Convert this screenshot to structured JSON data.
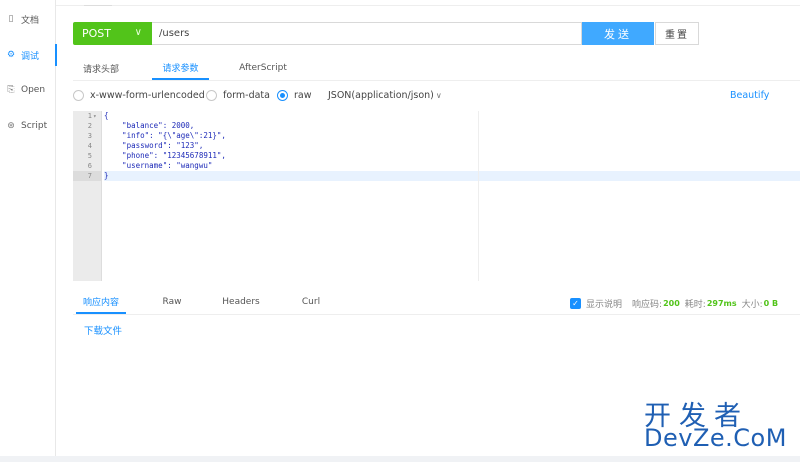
{
  "sidebar": {
    "items": [
      {
        "icon": "document-icon",
        "glyph": "▯",
        "label": "文档"
      },
      {
        "icon": "debug-icon",
        "glyph": "⚙",
        "label": "调试"
      },
      {
        "icon": "open-icon",
        "glyph": "⎘",
        "label": "Open"
      },
      {
        "icon": "script-icon",
        "glyph": "⊛",
        "label": "Script"
      }
    ]
  },
  "request": {
    "method": "POST",
    "url": "/users",
    "send_label": "发送",
    "reset_label": "重置"
  },
  "tabs": [
    "请求头部",
    "请求参数",
    "AfterScript"
  ],
  "body_options": {
    "x_www": "x-www-form-urlencoded",
    "form_data": "form-data",
    "raw": "raw",
    "content_type": "JSON(application/json)",
    "beautify": "Beautify"
  },
  "editor": {
    "lines": [
      "{",
      "    \"balance\": 2000,",
      "    \"info\": \"{\\\"age\\\":21}\",",
      "    \"password\": \"123\",",
      "    \"phone\": \"12345678911\",",
      "    \"username\": \"wangwu\"",
      "}"
    ],
    "line_numbers": [
      "1",
      "2",
      "3",
      "4",
      "5",
      "6",
      "7"
    ]
  },
  "response": {
    "tabs": [
      "响应内容",
      "Raw",
      "Headers",
      "Curl"
    ],
    "show_desc": "显示说明",
    "code_label": "响应码:",
    "code": "200",
    "time_label": "耗时:",
    "time": "297ms",
    "size_label": "大小:",
    "size": "0 B",
    "download": "下载文件"
  },
  "watermark": {
    "line1": "开发者",
    "line2": "DevZe.CoM"
  },
  "colors": {
    "primary": "#1890ff",
    "method_green": "#52c41a",
    "send_blue": "#40a9ff"
  }
}
